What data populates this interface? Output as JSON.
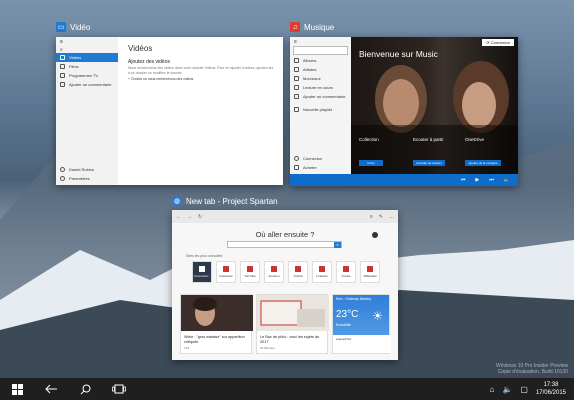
{
  "windows": {
    "video": {
      "title": "Vidéo",
      "content_title": "Vidéos",
      "sidebar_items": [
        "Vidéos",
        "Films",
        "Programmes TV",
        "Ajouter un commentaire"
      ],
      "sidebar_user": "Daniel Rubino",
      "sidebar_settings": "Paramètres",
      "section_title": "Ajoutez des vidéos",
      "section_text": "Nous recherchons des vidéos dans votre dossier Vidéos. Pour en ajouter d'autres, ajoutez-les à ce dossier ou modifiez le dossier.",
      "section_link": "Choisir où nous recherchons des vidéos"
    },
    "music": {
      "title": "Musique",
      "banner": "Bienvenue sur Music",
      "connect_button": "Connexion",
      "sidebar_items": [
        "Albums",
        "Artistes",
        "Morceaux",
        "Lecture en cours",
        "Ajouter un commentaire",
        "Nouvelle playlist"
      ],
      "sidebar_bottom": [
        "Connexion",
        "Acheter"
      ],
      "columns": [
        {
          "title": "Collection",
          "button": "Créer"
        },
        {
          "title": "Ecouter à partir",
          "button": "Accéder au dossier"
        },
        {
          "title": "OneDrive",
          "button": "Ajouter de la musique"
        }
      ]
    },
    "spartan": {
      "title": "New tab - Project Spartan",
      "search_heading": "Où aller ensuite ?",
      "search_placeholder": "",
      "top_sites_label": "Sites les plus consultés",
      "top_sites": [
        "Communit...",
        "Facebook",
        "YouTube",
        "Amazon",
        "Gofind",
        "Linkedin",
        "Create",
        "Wikipedia"
      ],
      "news": [
        {
          "headline": "Wixie : \"gros malaise\" sur apparition critiquée",
          "source": "TF1"
        },
        {
          "headline": "Le Bac de philo : voici les sujets de 2017",
          "source": "20 Minutes"
        }
      ],
      "weather": {
        "location": "Rive - Châtenay Malabry",
        "temp": "23°C",
        "condition": "Ensoleillé",
        "footer_label": "Aujourd'hui"
      }
    }
  },
  "taskbar": {
    "time": "17:38",
    "date": "17/06/2015"
  },
  "watermark": {
    "line1": "Windows 10 Pro Insider Preview",
    "line2": "Copie d'évaluation. Build 10130"
  },
  "colors": {
    "video_accent": "#1e7bd3",
    "music_accent": "#e03c31",
    "spartan_accent": "#2a7bd6",
    "music_bottom": "#0f6dc9",
    "taskbar": "#1f1f1f"
  }
}
